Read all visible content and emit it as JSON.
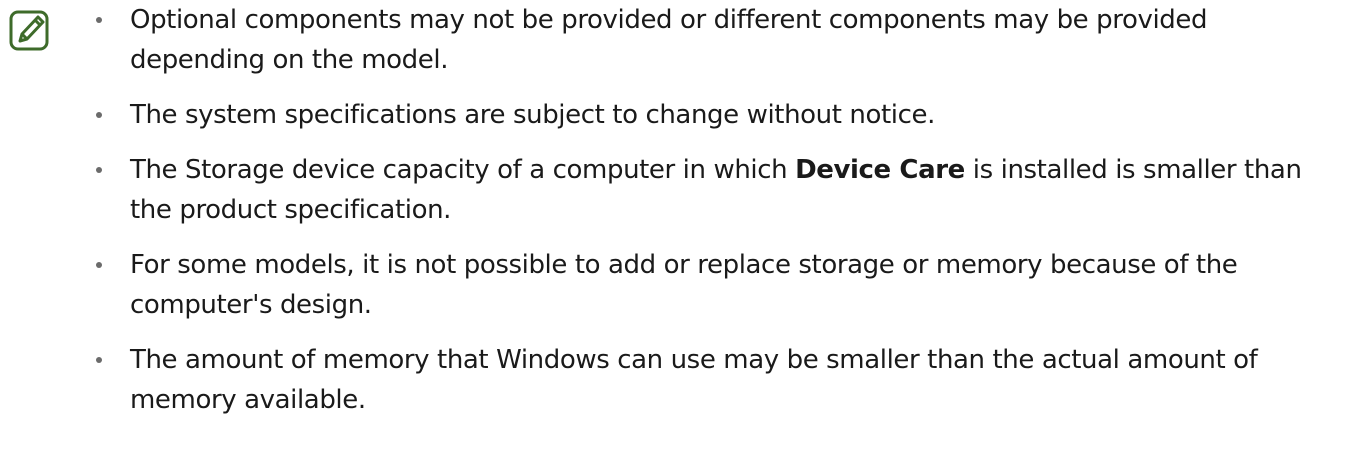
{
  "note_icon": "note-pencil-icon",
  "colors": {
    "icon": "#3e6b2a",
    "text": "#1a1a1a",
    "bullet": "#6b6b6b"
  },
  "notes": [
    {
      "text": "Optional components may not be provided or different components may be provided depending on the model."
    },
    {
      "text": "The system specifications are subject to change without notice."
    },
    {
      "text_before": "The Storage device capacity of a computer in which ",
      "bold": "Device Care",
      "text_after": " is installed is smaller than the product specification."
    },
    {
      "text": "For some models, it is not possible to add or replace storage or memory because of the computer's design."
    },
    {
      "text": "The amount of memory that Windows can use may be smaller than the actual amount of memory available."
    }
  ]
}
